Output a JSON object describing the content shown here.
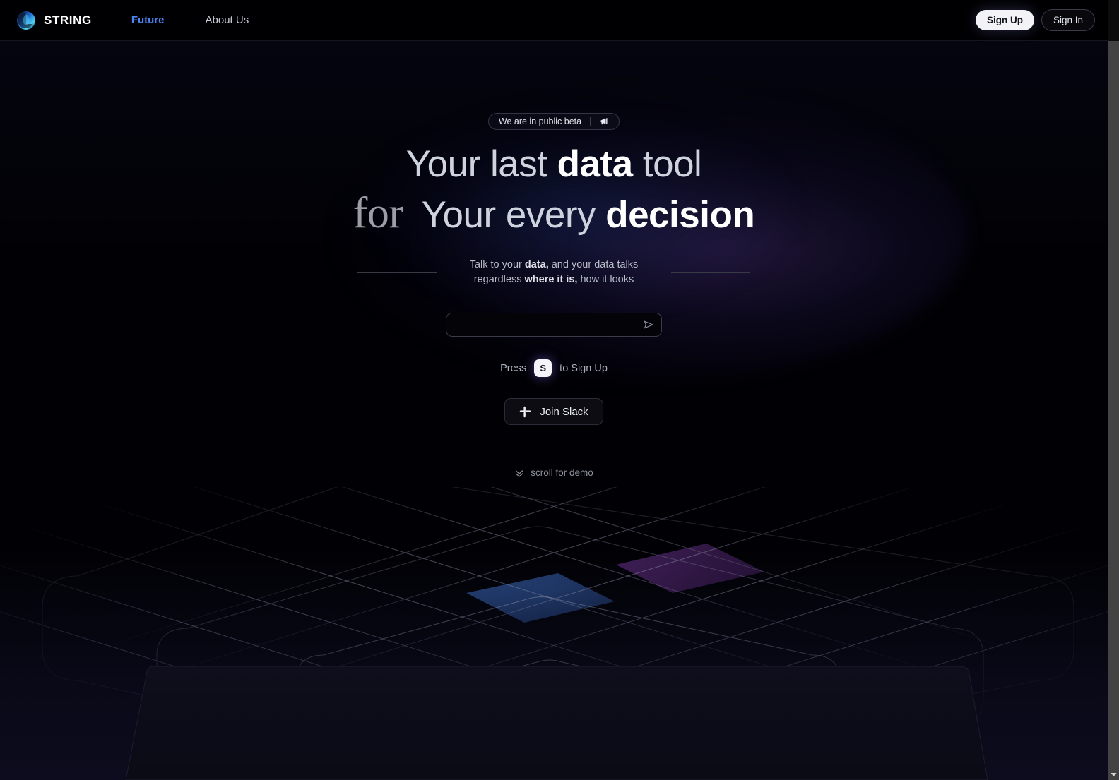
{
  "header": {
    "brand": {
      "name": "STRING",
      "logo_icon": "string-droplet-logo"
    },
    "nav": [
      {
        "label": "Future",
        "active": true
      },
      {
        "label": "About Us",
        "active": false
      }
    ],
    "actions": {
      "sign_up": "Sign Up",
      "sign_in": "Sign In"
    }
  },
  "hero": {
    "badge": {
      "text": "We are in public beta",
      "icon": "megaphone-icon"
    },
    "headline": {
      "line1": [
        {
          "text": "Your last ",
          "weight": "thin"
        },
        {
          "text": "data",
          "weight": "heavy"
        },
        {
          "text": " tool",
          "weight": "thin"
        }
      ],
      "for_word": "for",
      "line2": [
        {
          "text": "Your every ",
          "weight": "thin"
        },
        {
          "text": "decision",
          "weight": "heavy"
        }
      ]
    },
    "subtitle": {
      "part1": "Talk to your ",
      "bold1": "data,",
      "part2": " and your data talks regardless ",
      "bold2": "where it is,",
      "part3": " how it looks"
    },
    "search": {
      "value": "",
      "placeholder": "",
      "send_icon": "send-paper-plane-icon"
    },
    "press_hint": {
      "prefix": "Press",
      "key": "S",
      "suffix": "to Sign Up"
    },
    "slack_button": {
      "label": "Join Slack",
      "icon": "slack-icon"
    },
    "scroll_hint": {
      "label": "scroll for demo",
      "icon": "double-chevron-down-icon"
    }
  },
  "artwork": {
    "name": "isometric-grid-cube",
    "highlight_blue": "#1e3461",
    "highlight_purple": "#3b1f52",
    "line_color": "#6b6b82"
  },
  "colors": {
    "background": "#000005",
    "accent_blue": "#4d84f0",
    "glow_purple": "#6c48b4",
    "text_primary": "#ffffff",
    "text_muted": "#8d919c"
  },
  "scrollbar": {
    "name": "vertical-scrollbar",
    "arrow_icon": "chevron-down-icon"
  }
}
